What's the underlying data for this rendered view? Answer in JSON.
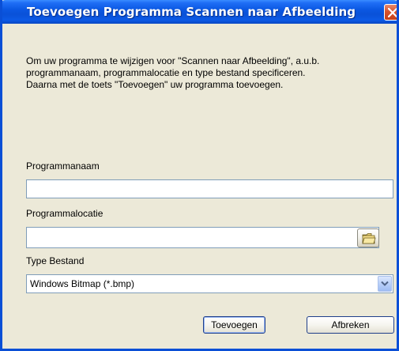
{
  "window": {
    "title": "Toevoegen Programma Scannen naar Afbeelding"
  },
  "instructions": {
    "line1": "Om uw programma te wijzigen voor \"Scannen naar Afbeelding\", a.u.b.",
    "line2": "programmanaam, programmalocatie en type bestand specificeren.",
    "line3": "Daarna met de toets \"Toevoegen\" uw programma toevoegen."
  },
  "fields": {
    "program_name_label": "Programmanaam",
    "program_name_value": "",
    "program_location_label": "Programmalocatie",
    "program_location_value": "",
    "file_type_label": "Type Bestand",
    "file_type_value": "Windows Bitmap (*.bmp)"
  },
  "buttons": {
    "add_label": "Toevoegen",
    "cancel_label": "Afbreken"
  },
  "icons": {
    "close": "close-icon",
    "browse": "folder-icon",
    "dropdown": "chevron-down-icon"
  },
  "colors": {
    "titlebar": "#0a51d8",
    "dialog_bg": "#ece9d8",
    "close_button": "#d8532d"
  }
}
